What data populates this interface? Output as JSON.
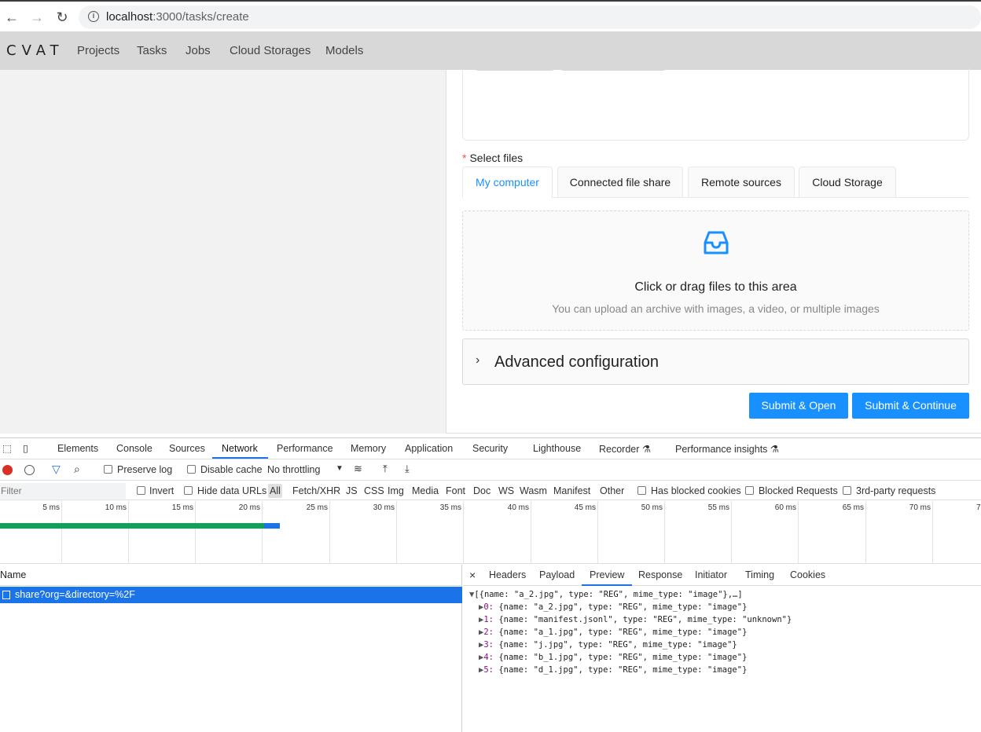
{
  "browser": {
    "url_host": "localhost",
    "url_path": ":3000/tasks/create"
  },
  "header": {
    "logo": "CVAT",
    "nav": [
      "Projects",
      "Tasks",
      "Jobs",
      "Cloud Storages",
      "Models"
    ]
  },
  "form": {
    "select_files_label": "Select files",
    "file_tabs": [
      "My computer",
      "Connected file share",
      "Remote sources",
      "Cloud Storage"
    ],
    "dropzone_title": "Click or drag files to this area",
    "dropzone_hint": "You can upload an archive with images, a video, or multiple images",
    "advanced_title": "Advanced configuration",
    "submit_open": "Submit & Open",
    "submit_continue": "Submit & Continue",
    "accent_color": "#1890ff"
  },
  "devtools": {
    "tabs": [
      "Elements",
      "Console",
      "Sources",
      "Network",
      "Performance",
      "Memory",
      "Application",
      "Security",
      "Lighthouse",
      "Recorder ⚗",
      "Performance insights ⚗"
    ],
    "active_tab": "Network",
    "toolbar": {
      "preserve_log": "Preserve log",
      "disable_cache": "Disable cache",
      "throttling": "No throttling"
    },
    "filter": {
      "placeholder": "Filter",
      "invert": "Invert",
      "hide_data_urls": "Hide data URLs",
      "types": [
        "All",
        "Fetch/XHR",
        "JS",
        "CSS",
        "Img",
        "Media",
        "Font",
        "Doc",
        "WS",
        "Wasm",
        "Manifest",
        "Other"
      ],
      "has_blocked_cookies": "Has blocked cookies",
      "blocked_requests": "Blocked Requests",
      "third_party": "3rd-party requests"
    },
    "timeline_ticks": [
      "5 ms",
      "10 ms",
      "15 ms",
      "20 ms",
      "25 ms",
      "30 ms",
      "35 ms",
      "40 ms",
      "45 ms",
      "50 ms",
      "55 ms",
      "60 ms",
      "65 ms",
      "70 ms",
      "7"
    ],
    "name_header": "Name",
    "request_name": "share?org=&directory=%2F",
    "detail_tabs": [
      "Headers",
      "Payload",
      "Preview",
      "Response",
      "Initiator",
      "Timing",
      "Cookies"
    ],
    "active_detail_tab": "Preview",
    "preview_summary": "[{name: \"a_2.jpg\", type: \"REG\", mime_type: \"image\"},…]",
    "preview_items": [
      {
        "index": "0:",
        "text": "{name: \"a_2.jpg\", type: \"REG\", mime_type: \"image\"}"
      },
      {
        "index": "1:",
        "text": "{name: \"manifest.jsonl\", type: \"REG\", mime_type: \"unknown\"}"
      },
      {
        "index": "2:",
        "text": "{name: \"a_1.jpg\", type: \"REG\", mime_type: \"image\"}"
      },
      {
        "index": "3:",
        "text": "{name: \"j.jpg\", type: \"REG\", mime_type: \"image\"}"
      },
      {
        "index": "4:",
        "text": "{name: \"b_1.jpg\", type: \"REG\", mime_type: \"image\"}"
      },
      {
        "index": "5:",
        "text": "{name: \"d_1.jpg\", type: \"REG\", mime_type: \"image\"}"
      }
    ]
  }
}
